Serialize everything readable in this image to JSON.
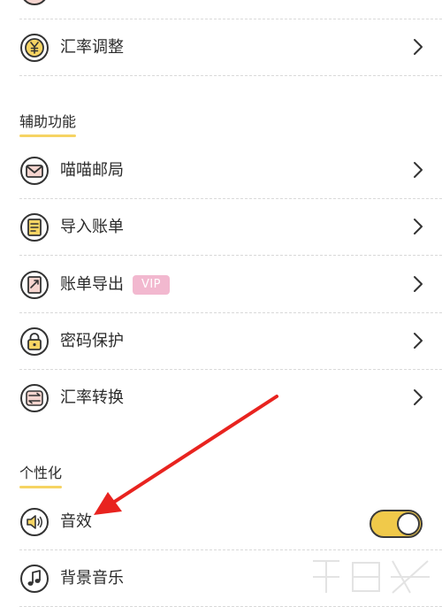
{
  "rows": {
    "exchange_adjust": {
      "label": "汇率调整",
      "icon": "yen-coin-icon"
    },
    "meow_post": {
      "label": "喵喵邮局",
      "icon": "envelope-icon"
    },
    "import_bill": {
      "label": "导入账单",
      "icon": "import-document-icon"
    },
    "export_bill": {
      "label": "账单导出",
      "icon": "export-document-icon",
      "badge": "VIP"
    },
    "password_protect": {
      "label": "密码保护",
      "icon": "lock-icon"
    },
    "exchange_convert": {
      "label": "汇率转换",
      "icon": "exchange-arrows-icon"
    },
    "sound_effect": {
      "label": "音效",
      "icon": "speaker-icon",
      "toggle_on": true
    },
    "bg_music": {
      "label": "背景音乐",
      "icon": "music-note-icon"
    }
  },
  "sections": {
    "assist": "辅助功能",
    "personalize": "个性化"
  },
  "colors": {
    "accent_yellow": "#f6d463",
    "toggle_yellow": "#f0c94a",
    "vip_pink": "#f2b8cf",
    "icon_fill": "#f5d5cf",
    "arrow_red": "#e8231f"
  }
}
